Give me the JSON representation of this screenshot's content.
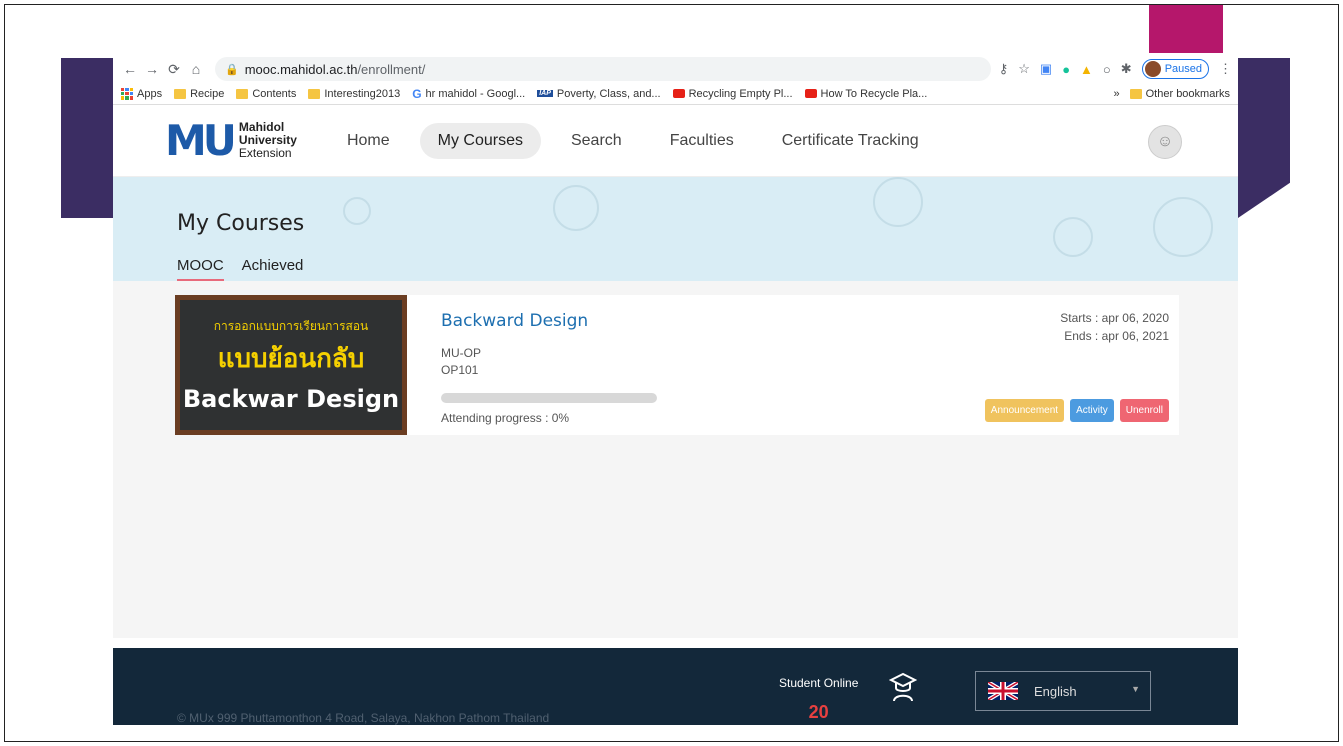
{
  "browser": {
    "url_host": "mooc.mahidol.ac.th",
    "url_path": "/enrollment/",
    "profile_status": "Paused",
    "bookmarks": [
      {
        "label": "Apps",
        "icon": "apps-grid-icon"
      },
      {
        "label": "Recipe",
        "icon": "folder-icon"
      },
      {
        "label": "Contents",
        "icon": "folder-icon"
      },
      {
        "label": "Interesting2013",
        "icon": "folder-icon"
      },
      {
        "label": "hr mahidol - Googl...",
        "icon": "google-icon"
      },
      {
        "label": "Poverty, Class, and...",
        "icon": "iap-icon"
      },
      {
        "label": "Recycling Empty Pl...",
        "icon": "youtube-icon"
      },
      {
        "label": "How To Recycle Pla...",
        "icon": "youtube-icon"
      }
    ],
    "more_label": "»",
    "other_bookmarks": "Other bookmarks"
  },
  "site": {
    "logo": {
      "mark": "MU",
      "line1": "Mahidol",
      "line2": "University",
      "line3": "Extension"
    },
    "nav": [
      {
        "label": "Home",
        "active": false
      },
      {
        "label": "My Courses",
        "active": true
      },
      {
        "label": "Search",
        "active": false
      },
      {
        "label": "Faculties",
        "active": false
      },
      {
        "label": "Certificate Tracking",
        "active": false
      }
    ]
  },
  "page": {
    "title": "My Courses",
    "tabs": [
      {
        "label": "MOOC",
        "active": true
      },
      {
        "label": "Achieved",
        "active": false
      }
    ]
  },
  "course": {
    "thumb_line1": "การออกแบบการเรียนการสอน",
    "thumb_line2": "แบบย้อนกลับ",
    "thumb_line3": "Backwar Design",
    "title": "Backward Design",
    "org": "MU-OP",
    "code": "OP101",
    "progress": 0,
    "progress_label": "Attending progress : 0%",
    "starts": "Starts : apr 06, 2020",
    "ends": "Ends : apr 06, 2021",
    "buttons": {
      "announcement": "Announcement",
      "activity": "Activity",
      "unenroll": "Unenroll"
    }
  },
  "footer": {
    "copyright": "© MUx 999 Phuttamonthon 4 Road, Salaya, Nakhon Pathom Thailand",
    "student_online_label": "Student Online",
    "student_online_count": "20",
    "language": "English"
  },
  "colors": {
    "accent": "#1d6fb0",
    "banner": "#d9edf5",
    "footer": "#13283a",
    "announcement": "#f0c35e",
    "activity": "#4c9be0",
    "unenroll": "#ef6672"
  }
}
